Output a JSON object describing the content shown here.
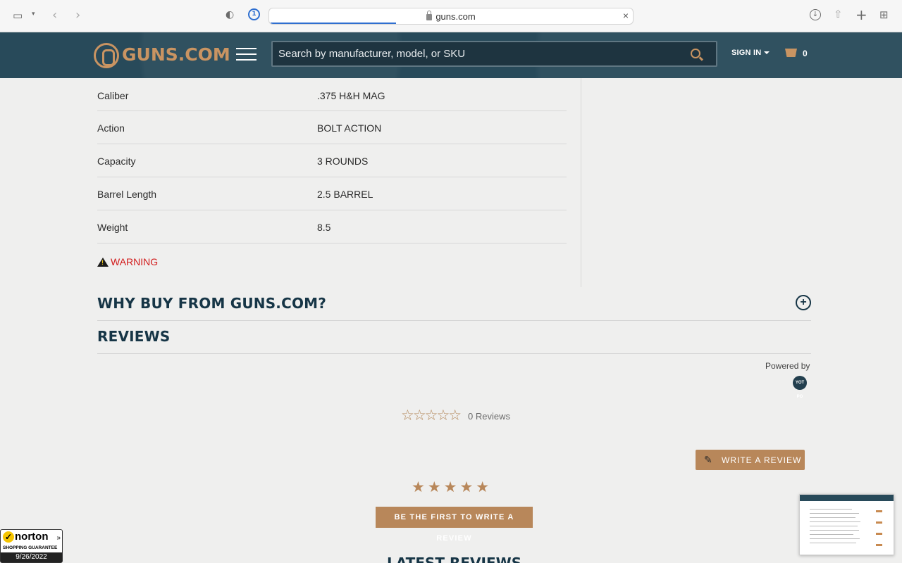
{
  "browser": {
    "url": "guns.com"
  },
  "header": {
    "logo_text": "GUNS.COM",
    "search_placeholder": "Search by manufacturer, model, or SKU",
    "sign_in": "SIGN IN",
    "cart_count": "0"
  },
  "specs": [
    {
      "label": "Caliber",
      "value": ".375 H&H MAG"
    },
    {
      "label": "Action",
      "value": "BOLT ACTION"
    },
    {
      "label": "Capacity",
      "value": "3 ROUNDS"
    },
    {
      "label": "Barrel Length",
      "value": "2.5 BARREL"
    },
    {
      "label": "Weight",
      "value": "8.5"
    }
  ],
  "warning_label": "WARNING",
  "why_buy_title": "WHY BUY FROM GUNS.COM?",
  "reviews": {
    "title": "REVIEWS",
    "powered_by": "Powered by",
    "powered_logo": "YOT PO",
    "rating_stars": 0,
    "count_text": "0 Reviews",
    "write_review_label": "WRITE A REVIEW",
    "first_review_label": "BE THE FIRST TO WRITE A REVIEW",
    "latest_title": "LATEST REVIEWS"
  },
  "norton": {
    "brand": "norton",
    "subtitle": "SHOPPING GUARANTEE",
    "date": "9/26/2022"
  },
  "colors": {
    "header_bg": "#284a5a",
    "accent": "#b8875a",
    "warning": "#d21b1b",
    "heading": "#163546"
  }
}
